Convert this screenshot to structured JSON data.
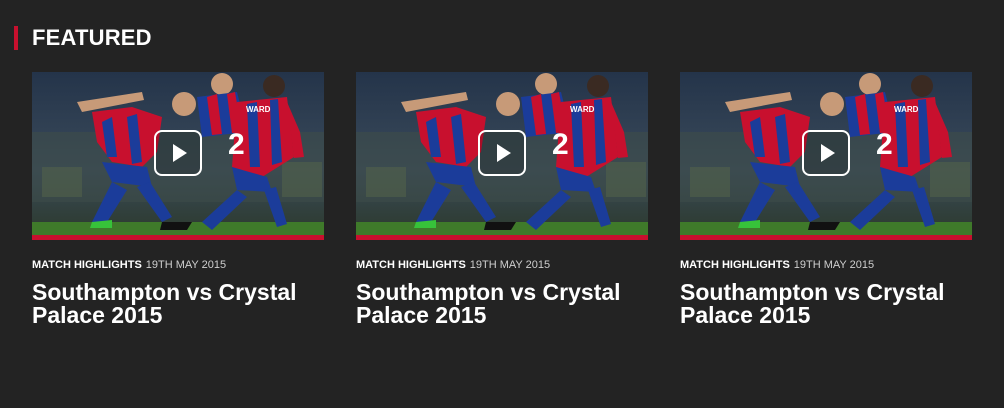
{
  "section": {
    "title": "FEATURED",
    "accent_color": "#c8102e"
  },
  "cards": [
    {
      "category": "MATCH HIGHLIGHTS",
      "date": "19TH MAY 2015",
      "title": "Southampton vs Crystal Palace 2015",
      "player_numbers": [
        "2"
      ],
      "shirt_name": "WARD",
      "icon": "play-icon"
    },
    {
      "category": "MATCH HIGHLIGHTS",
      "date": "19TH MAY 2015",
      "title": "Southampton vs Crystal Palace 2015",
      "player_numbers": [
        "2"
      ],
      "shirt_name": "WARD",
      "icon": "play-icon"
    },
    {
      "category": "MATCH HIGHLIGHTS",
      "date": "19TH MAY 2015",
      "title": "Southampton vs Crystal Palace 2015",
      "player_numbers": [
        "2"
      ],
      "shirt_name": "WARD",
      "icon": "play-icon"
    }
  ]
}
